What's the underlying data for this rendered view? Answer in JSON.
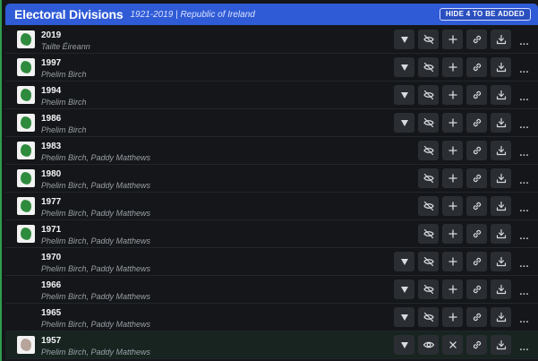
{
  "header": {
    "title": "Electoral Divisions",
    "subtitle": "1921-2019 | Republic of Ireland",
    "hide_button_label": "HIDE 4 TO BE ADDED"
  },
  "more_label": "...",
  "rows": [
    {
      "year": "2019",
      "author": "Tailte Éireann",
      "thumb": "ireland-map-icon",
      "has_dropdown": true,
      "selected": false
    },
    {
      "year": "1997",
      "author": "Phelim Birch",
      "thumb": "ireland-map-icon",
      "has_dropdown": true,
      "selected": false
    },
    {
      "year": "1994",
      "author": "Phelim Birch",
      "thumb": "ireland-map-icon",
      "has_dropdown": true,
      "selected": false
    },
    {
      "year": "1986",
      "author": "Phelim Birch",
      "thumb": "ireland-map-icon",
      "has_dropdown": true,
      "selected": false
    },
    {
      "year": "1983",
      "author": "Phelim Birch, Paddy Matthews",
      "thumb": "ireland-map-icon",
      "has_dropdown": false,
      "selected": false
    },
    {
      "year": "1980",
      "author": "Phelim Birch, Paddy Matthews",
      "thumb": "ireland-map-icon",
      "has_dropdown": false,
      "selected": false
    },
    {
      "year": "1977",
      "author": "Phelim Birch, Paddy Matthews",
      "thumb": "ireland-map-icon",
      "has_dropdown": false,
      "selected": false
    },
    {
      "year": "1971",
      "author": "Phelim Birch, Paddy Matthews",
      "thumb": "ireland-map-icon",
      "has_dropdown": false,
      "selected": false
    },
    {
      "year": "1970",
      "author": "Phelim Birch, Paddy Matthews",
      "thumb": null,
      "has_dropdown": true,
      "selected": false
    },
    {
      "year": "1966",
      "author": "Phelim Birch, Paddy Matthews",
      "thumb": null,
      "has_dropdown": true,
      "selected": false
    },
    {
      "year": "1965",
      "author": "Phelim Birch, Paddy Matthews",
      "thumb": null,
      "has_dropdown": true,
      "selected": false
    },
    {
      "year": "1957",
      "author": "Phelim Birch, Paddy Matthews",
      "thumb": "ireland-map-icon-light",
      "has_dropdown": true,
      "selected": true
    }
  ],
  "icons": {
    "dropdown": "triangle-down-icon",
    "hidden": "eye-off-icon",
    "visible": "eye-icon",
    "add": "plus-icon",
    "remove": "x-icon",
    "link": "link-icon",
    "download": "download-icon"
  },
  "colors": {
    "header_bg": "#2f5bd6",
    "accent_green": "#2e9c4f",
    "button_bg": "#2a2e33"
  }
}
